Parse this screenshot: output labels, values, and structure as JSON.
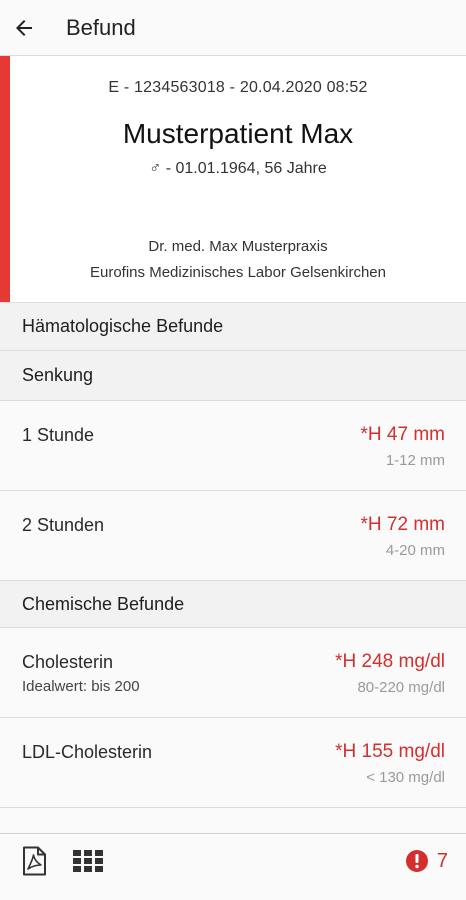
{
  "appbar": {
    "title": "Befund",
    "back_icon": "arrow-left-icon"
  },
  "patient": {
    "order_line": "E - 1234563018 - 20.04.2020 08:52",
    "name": "Musterpatient Max",
    "gender_symbol": "♂",
    "dob_line": " - 01.01.1964, 56 Jahre",
    "doctor": "Dr. med. Max Musterpraxis",
    "lab": "Eurofins Medizinisches Labor Gelsenkirchen",
    "accent_color": "#e53935"
  },
  "sections": {
    "hematology": "Hämatologische Befunde",
    "senkung": "Senkung",
    "chemistry": "Chemische Befunde"
  },
  "results": [
    {
      "name": "1 Stunde",
      "note": "",
      "value": "*H 47 mm",
      "range": "1-12 mm"
    },
    {
      "name": "2 Stunden",
      "note": "",
      "value": "*H 72 mm",
      "range": "4-20 mm"
    },
    {
      "name": "Cholesterin",
      "note": "Idealwert: bis 200",
      "value": "*H 248 mg/dl",
      "range": "80-220 mg/dl"
    },
    {
      "name": "LDL-Cholesterin",
      "note": "",
      "value": "*H 155 mg/dl",
      "range": "< 130 mg/dl"
    }
  ],
  "bottombar": {
    "pdf_icon": "pdf-icon",
    "grid_icon": "grid-icon",
    "alert_icon": "alert-icon",
    "alert_count": "7"
  },
  "colors": {
    "flag_red": "#d32f2f",
    "accent": "#e53935"
  }
}
